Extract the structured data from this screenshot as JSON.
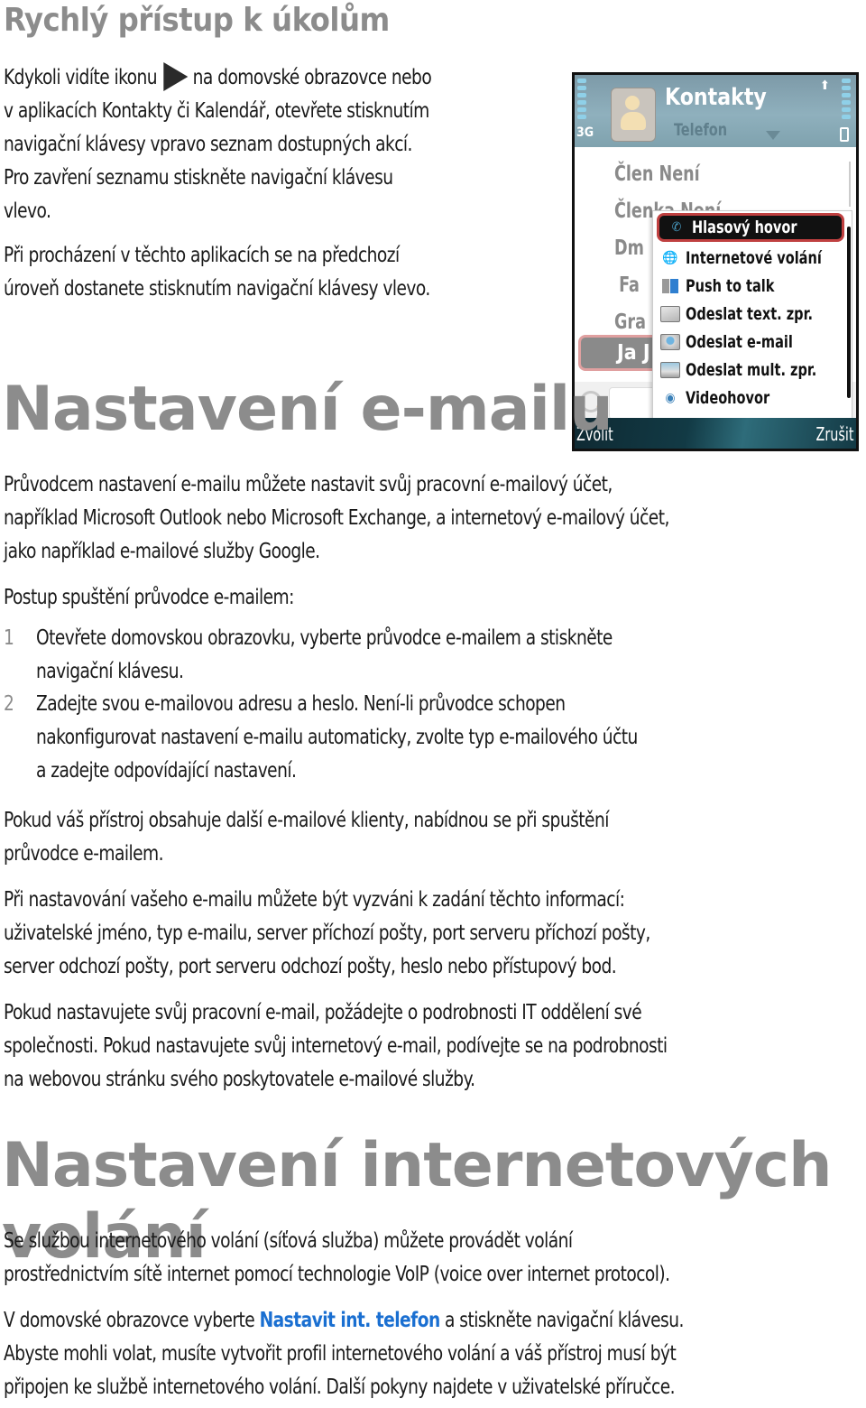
{
  "section1": {
    "title": "Rychlý přístup k úkolům",
    "para1_before_icon": "Kdykoli vidíte ikonu",
    "para1_icon": "right-arrow-triangle",
    "para1_after_icon": "na domovské obrazovce nebo",
    "para1_lines": [
      "v aplikacích Kontakty či Kalendář, otevřete stisknutím",
      "navigační klávesy vpravo seznam dostupných akcí.",
      "Pro zavření seznamu stiskněte navigační klávesu",
      "vlevo."
    ],
    "para2_lines": [
      "Při procházení v těchto aplikacích se na předchozí",
      "úroveň dostanete stisknutím navigační klávesy vlevo."
    ]
  },
  "phone": {
    "network": "3G",
    "app_title": "Kontakty",
    "subtitle": "Telefon",
    "contacts": [
      "Člen Není",
      "Členka Není",
      "Dm",
      "Fa",
      "Gra"
    ],
    "selected_contact": "Ja J",
    "menu": [
      {
        "label": "Hlasový hovor",
        "icon": "phone-handset",
        "active": true
      },
      {
        "label": "Internetové volání",
        "icon": "internet-call"
      },
      {
        "label": "Push to talk",
        "icon": "push-to-talk"
      },
      {
        "label": "Odeslat text. zpr.",
        "icon": "envelope"
      },
      {
        "label": "Odeslat e-mail",
        "icon": "email-envelope"
      },
      {
        "label": "Odeslat mult. zpr.",
        "icon": "multimedia-envelope"
      },
      {
        "label": "Videohovor",
        "icon": "video-call"
      }
    ],
    "softkey_left": "Zvolit",
    "softkey_right": "Zrušit"
  },
  "section2": {
    "title": "Nastavení e-mailu",
    "intro_lines": [
      "Průvodcem nastavení e-mailu můžete nastavit svůj pracovní e-mailový účet,",
      "například Microsoft Outlook nebo Microsoft Exchange, a internetový e-mailový účet,",
      "jako například e-mailové služby Google."
    ],
    "steps_intro": "Postup spuštění průvodce e-mailem:",
    "steps": [
      {
        "num": "1",
        "lines": [
          "Otevřete domovskou obrazovku, vyberte průvodce e-mailem a stiskněte",
          "navigační klávesu."
        ]
      },
      {
        "num": "2",
        "lines": [
          "Zadejte svou e-mailovou adresu a heslo. Není-li průvodce schopen",
          "nakonfigurovat nastavení e-mailu automaticky, zvolte typ e-mailového účtu",
          "a zadejte odpovídající nastavení."
        ]
      }
    ],
    "para_clients": [
      "Pokud váš přístroj obsahuje další e-mailové klienty, nabídnou se při spuštění",
      "průvodce e-mailem."
    ],
    "para_info": [
      "Při nastavování vašeho e-mailu můžete být vyzváni k zadání těchto informací:",
      "uživatelské jméno, typ e-mailu, server příchozí pošty, port serveru příchozí pošty,",
      "server odchozí pošty, port serveru odchozí pošty, heslo nebo přístupový bod."
    ],
    "para_work": [
      "Pokud nastavujete svůj pracovní e-mail, požádejte o podrobnosti IT oddělení své",
      "společnosti. Pokud nastavujete svůj internetový e-mail, podívejte se na podrobnosti",
      "na webovou stránku svého poskytovatele e-mailové služby."
    ]
  },
  "section3": {
    "title": "Nastavení internetových volání",
    "para1": [
      "Se službou internetového volání (síťová služba) můžete provádět volání",
      "prostřednictvím sítě internet pomocí technologie VoIP (voice over internet protocol)."
    ],
    "para2_before_link": "V domovské obrazovce vyberte ",
    "para2_link": "Nastavit int. telefon",
    "para2_after_link": " a stiskněte navigační klávesu.",
    "para2_lines": [
      "Abyste mohli volat, musíte vytvořit profil internetového volání a váš přístroj musí být",
      "připojen ke službě internetového volání. Další pokyny najdete v uživatelské příručce."
    ]
  },
  "colors": {
    "heading": "#8c8c8c",
    "text": "#1a1a1a",
    "link": "#1a6fd1"
  }
}
